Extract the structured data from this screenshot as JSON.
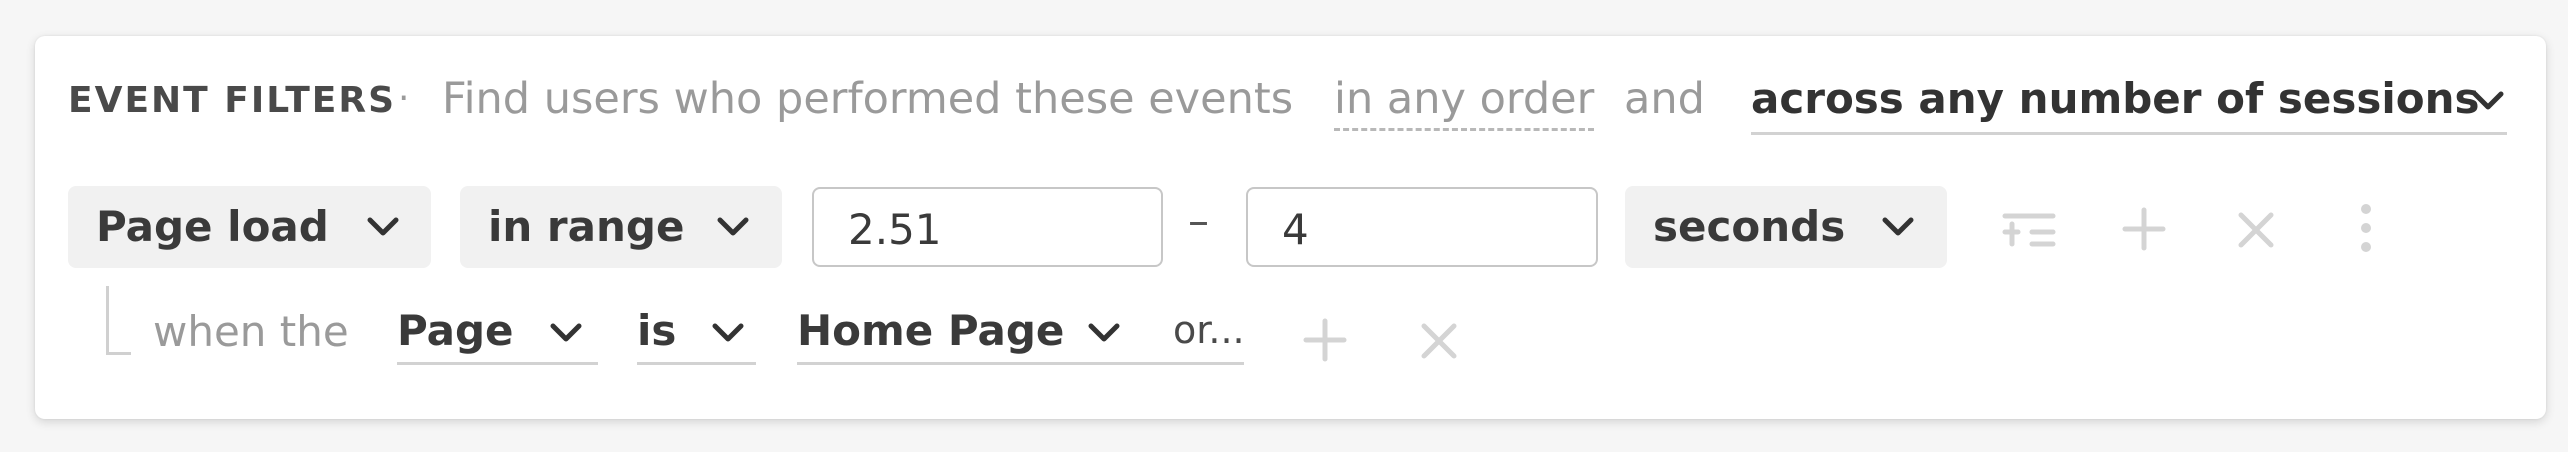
{
  "header": {
    "title": "EVENT FILTERS",
    "separator": "·",
    "description": "Find users who performed these events",
    "order_option": "in any order",
    "conjunction": "and",
    "sessions_option": "across any number of sessions"
  },
  "event_filter": {
    "event": "Page load",
    "operator": "in range",
    "range_min": "2.51",
    "range_separator": "–",
    "range_max": "4",
    "unit": "seconds"
  },
  "property_filter": {
    "prefix": "when the",
    "property": "Page",
    "operator": "is",
    "value": "Home Page",
    "or_label": "or..."
  },
  "icons": {
    "row1": [
      "filter-add-icon",
      "plus-icon",
      "close-icon",
      "more-vertical-icon"
    ],
    "row2": [
      "plus-icon",
      "close-icon"
    ],
    "chevron": "chevron-down-icon"
  },
  "colors": {
    "card_background": "#ffffff",
    "pill_background": "#f1f1f1",
    "muted_text": "#9a9a9a",
    "disabled_icon": "#d4d4d4"
  }
}
